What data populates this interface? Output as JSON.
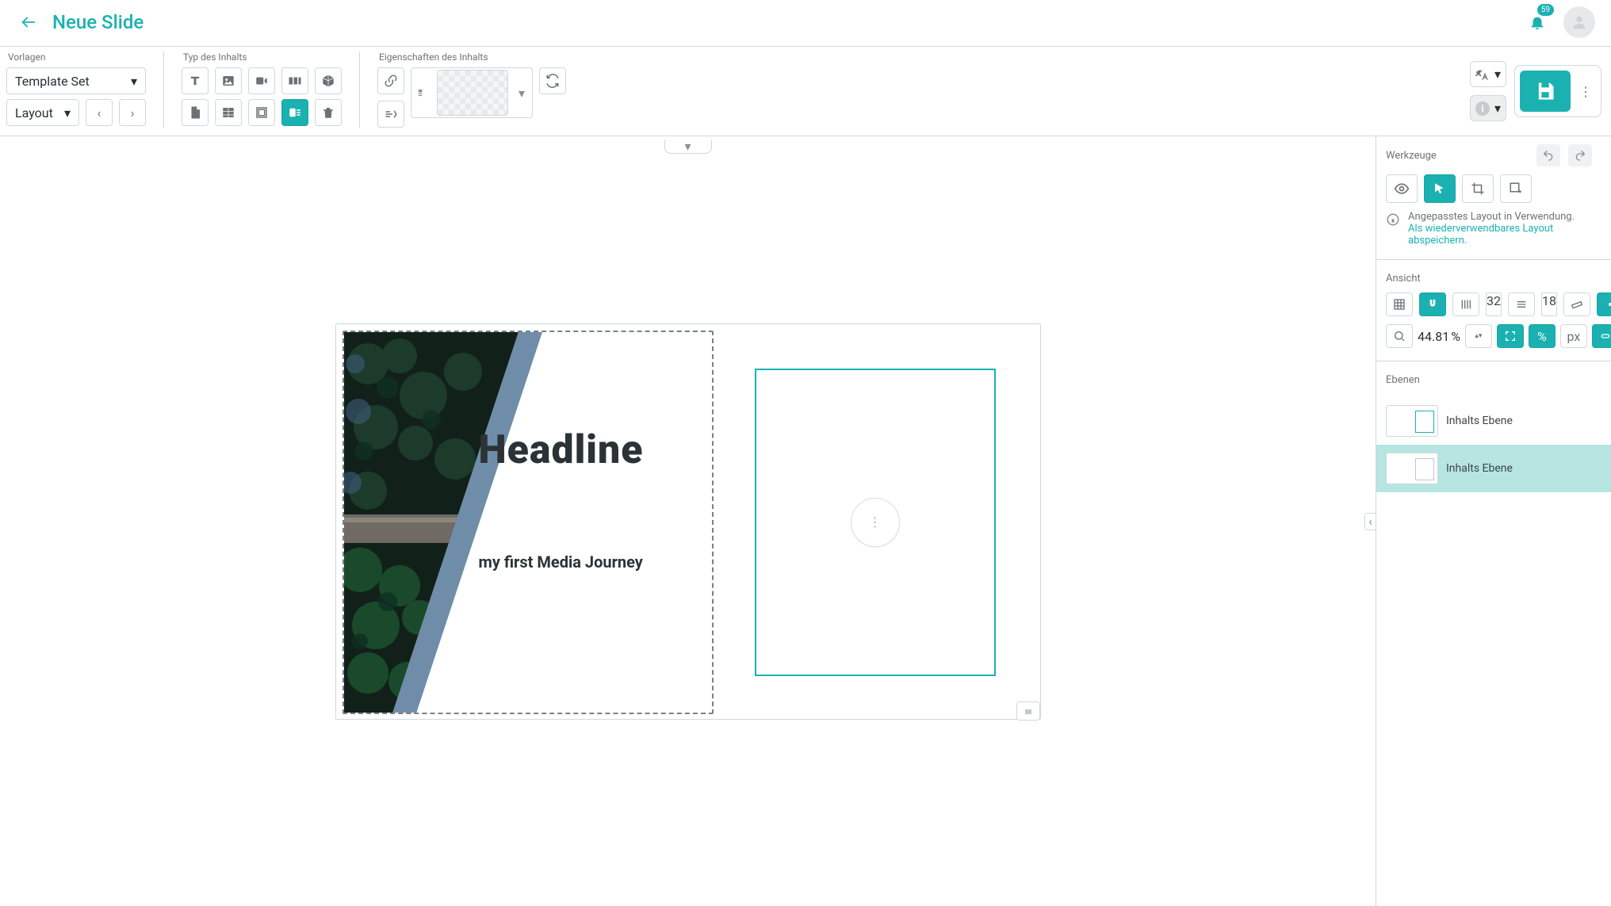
{
  "page": {
    "title": "Neue Slide"
  },
  "header": {
    "notifications_count": "59"
  },
  "toolbar": {
    "vorlagen_label": "Vorlagen",
    "typ_label": "Typ des Inhalts",
    "eigenschaften_label": "Eigenschaften des Inhalts",
    "template_set": "Template Set",
    "layout": "Layout"
  },
  "canvas": {
    "headline": "Headline",
    "subheadline": "my first Media Journey"
  },
  "sidepanel": {
    "werkzeuge": "Werkzeuge",
    "layout_note_line1": "Angepasstes Layout in Verwendung.",
    "layout_note_link1": "Als wiederverwendbares Layout",
    "layout_note_link2": "abspeichern.",
    "ansicht": "Ansicht",
    "grid_value": "32",
    "spacing_value": "18",
    "zoom_value": "44.81",
    "zoom_unit": "%",
    "unit_label": "px",
    "ebenen_label": "Ebenen",
    "layers": [
      "Inhalts Ebene",
      "Inhalts Ebene"
    ]
  }
}
